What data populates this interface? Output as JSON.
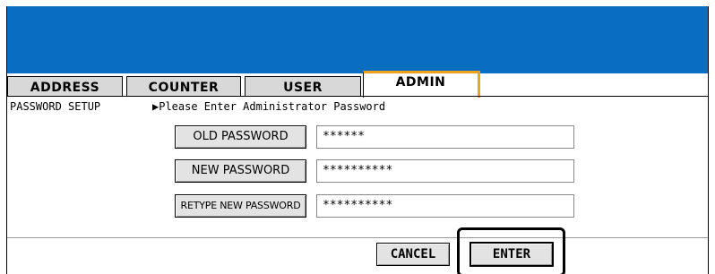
{
  "tabs": [
    {
      "label": "ADDRESS"
    },
    {
      "label": "COUNTER"
    },
    {
      "label": "USER"
    },
    {
      "label": "ADMIN"
    }
  ],
  "header": {
    "section": "PASSWORD SETUP",
    "instruction": "▶Please Enter Administrator Password"
  },
  "form": {
    "old_password": {
      "label": "OLD PASSWORD",
      "value": "******"
    },
    "new_password": {
      "label": "NEW PASSWORD",
      "value": "**********"
    },
    "retype_password": {
      "label": "RETYPE NEW PASSWORD",
      "value": "**********"
    }
  },
  "footer": {
    "cancel_label": "CANCEL",
    "enter_label": "ENTER"
  },
  "colors": {
    "topbar": "#0a6ec0",
    "active_tab_accent": "#f0a21d"
  }
}
